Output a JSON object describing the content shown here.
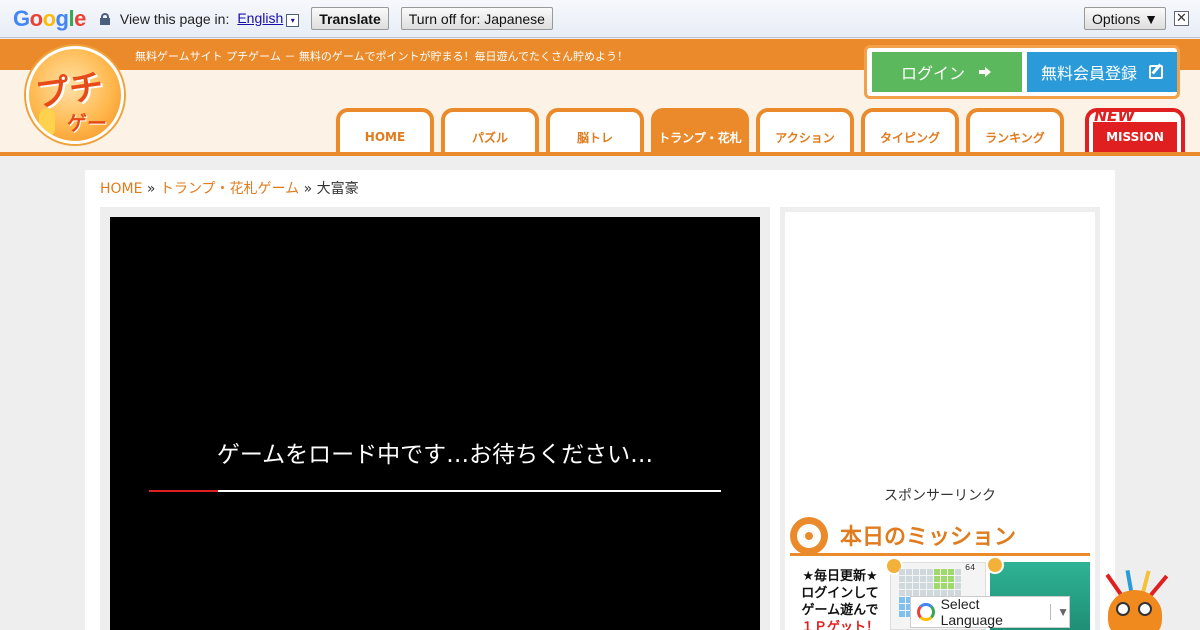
{
  "translate_bar": {
    "logo": [
      "G",
      "o",
      "o",
      "g",
      "l",
      "e"
    ],
    "prompt": "View this page in:",
    "language": "English",
    "caret": "▾",
    "translate_label": "Translate",
    "turn_off_label": "Turn off for: Japanese",
    "options_label": "Options ▼",
    "close_glyph": "✕"
  },
  "header": {
    "tagline": "無料ゲームサイト プチゲーム － 無料のゲームでポイントが貯まる！毎日遊んでたくさん貯めよう！",
    "logo_line1": "プチ",
    "logo_line2": "ゲーム",
    "login_label": "ログイン",
    "register_label": "無料会員登録"
  },
  "nav": {
    "tabs": [
      {
        "label": "HOME"
      },
      {
        "label": "パズル"
      },
      {
        "label": "脳トレ"
      },
      {
        "label": "トランプ・花札"
      },
      {
        "label": "アクション"
      },
      {
        "label": "タイピング"
      },
      {
        "label": "ランキング"
      }
    ],
    "active_index": 3,
    "mission_new": "NEW",
    "mission_label": "MISSION"
  },
  "breadcrumb": {
    "home": "HOME",
    "sep1": " » ",
    "category": "トランプ・花札ゲーム",
    "sep2": " » ",
    "current": "大富豪"
  },
  "game": {
    "loading_text": "ゲームをロード中です…お待ちください…",
    "progress": 0.12
  },
  "sidebar": {
    "sponsor": "スポンサーリンク",
    "mission_title": "本日のミッション",
    "note_line1": "★毎日更新★",
    "note_line2": "ログインして",
    "note_line3": "ゲーム遊んで",
    "note_line4": "１Ｐゲット！",
    "thumb_number": "64"
  },
  "select_language": {
    "label": "Select Language",
    "arrow": "▼"
  },
  "colors": {
    "brand_orange": "#ea8a2b",
    "login_green": "#5cb85c",
    "register_blue": "#2a9bd8",
    "mission_red": "#e02020"
  }
}
